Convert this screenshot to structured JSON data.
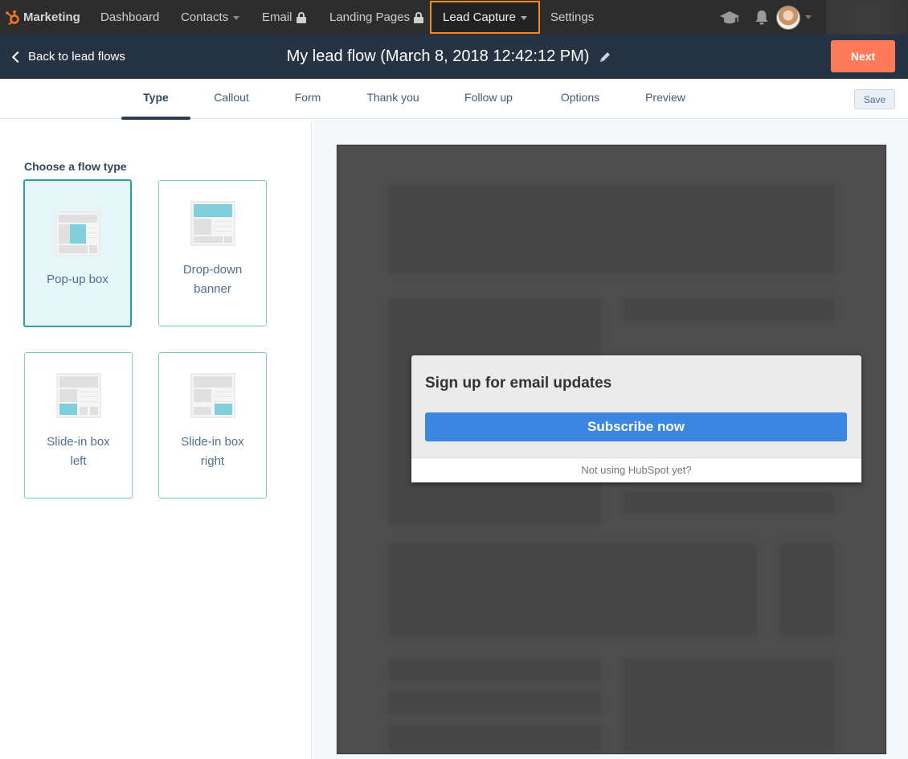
{
  "topnav": {
    "brand": "Marketing",
    "items": [
      {
        "label": "Dashboard"
      },
      {
        "label": "Contacts"
      },
      {
        "label": "Email"
      },
      {
        "label": "Landing Pages"
      },
      {
        "label": "Lead Capture"
      },
      {
        "label": "Settings"
      }
    ],
    "accent_color": "#f08a24"
  },
  "header": {
    "back_label": "Back to lead flows",
    "title": "My lead flow (March 8, 2018 12:42:12 PM)",
    "next_label": "Next",
    "next_color": "#ff7a59"
  },
  "tabs": {
    "items": [
      {
        "label": "Type"
      },
      {
        "label": "Callout"
      },
      {
        "label": "Form"
      },
      {
        "label": "Thank you"
      },
      {
        "label": "Follow up"
      },
      {
        "label": "Options"
      },
      {
        "label": "Preview"
      }
    ],
    "active": "Type",
    "save_label": "Save"
  },
  "flow_type": {
    "heading": "Choose a flow type",
    "selected": "Pop-up box",
    "options": [
      {
        "line1": "Pop-up box",
        "line2": ""
      },
      {
        "line1": "Drop-down",
        "line2": "banner"
      },
      {
        "line1": "Slide-in box",
        "line2": "left"
      },
      {
        "line1": "Slide-in box",
        "line2": "right"
      }
    ]
  },
  "preview": {
    "popup_title": "Sign up for email updates",
    "button_label": "Subscribe now",
    "button_color": "#3a86e0",
    "footer_text": "Not using HubSpot yet?"
  }
}
